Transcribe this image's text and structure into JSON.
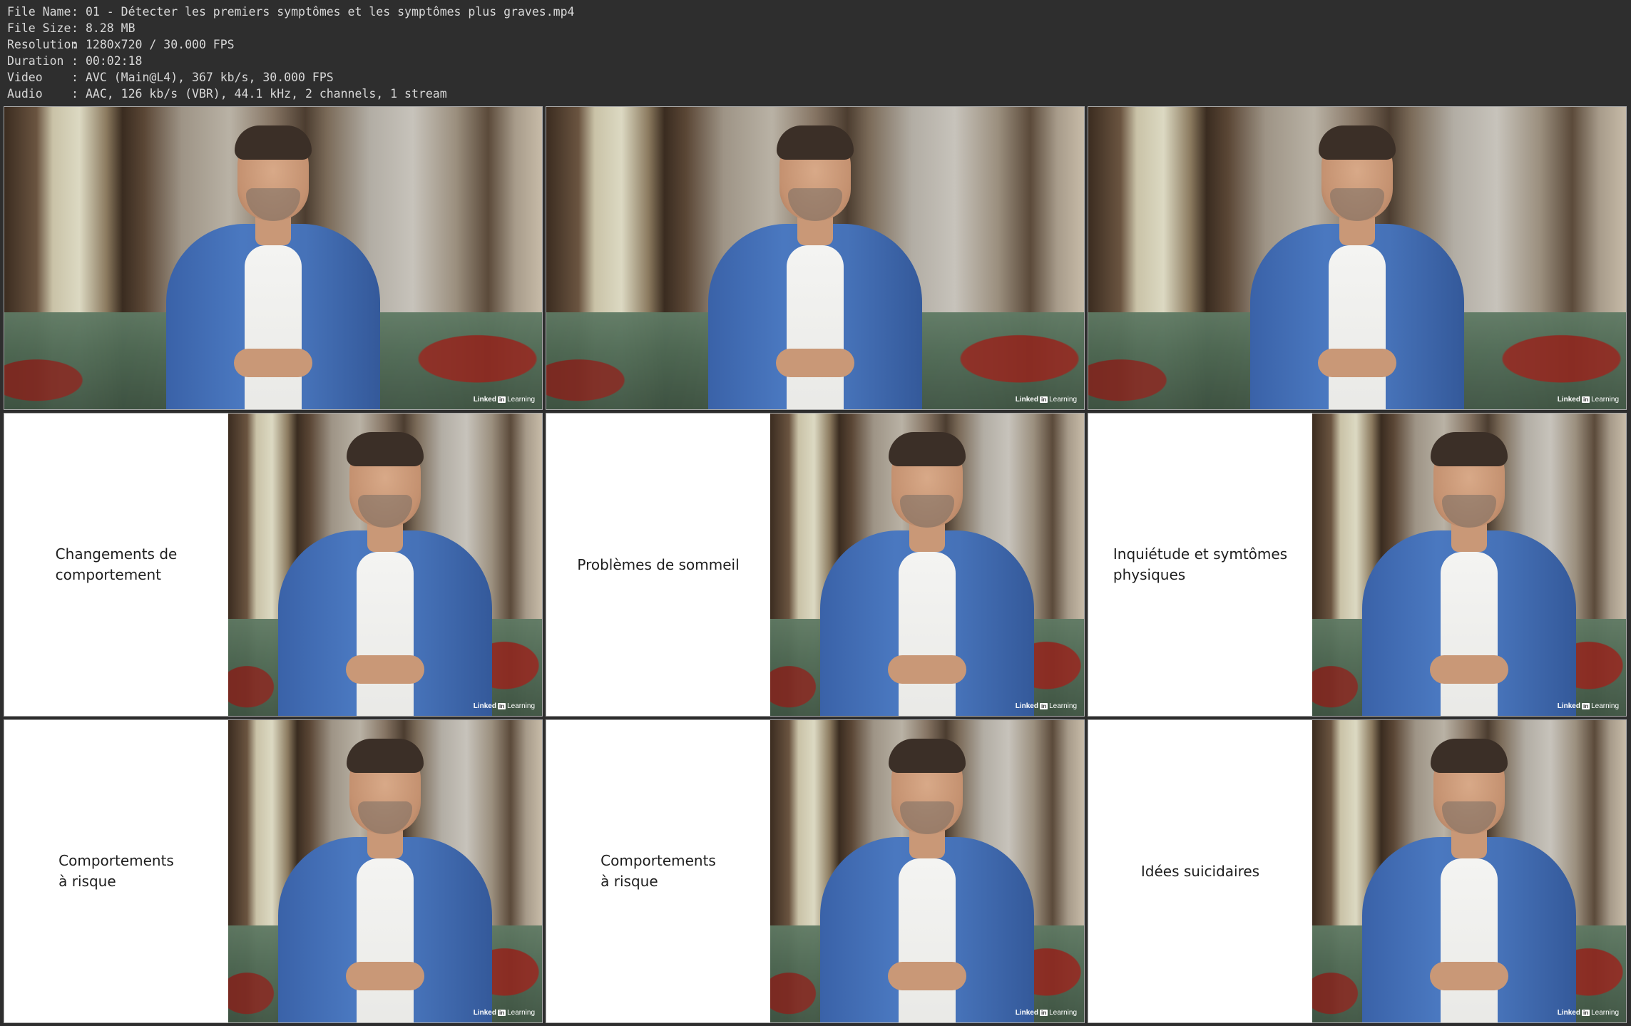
{
  "metadata": [
    {
      "key": "File Name",
      "sep": ":",
      "value": "01 - Détecter les premiers symptômes et les symptômes plus graves.mp4"
    },
    {
      "key": "File Size",
      "sep": ":",
      "value": "8.28 MB"
    },
    {
      "key": "Resolution",
      "sep": ":",
      "value": "1280x720 / 30.000 FPS"
    },
    {
      "key": "Duration",
      "sep": ":",
      "value": "00:02:18"
    },
    {
      "key": "Video",
      "sep": ":",
      "value": "AVC (Main@L4), 367 kb/s, 30.000 FPS"
    },
    {
      "key": "Audio",
      "sep": ":",
      "value": "AAC, 126 kb/s (VBR), 44.1 kHz, 2 channels, 1 stream"
    }
  ],
  "logo": {
    "linked": "Linked",
    "in": "in",
    "learning": "Learning"
  },
  "frames": [
    {
      "caption": ""
    },
    {
      "caption": ""
    },
    {
      "caption": ""
    },
    {
      "caption": "Changements de\ncomportement"
    },
    {
      "caption": "Problèmes de sommeil"
    },
    {
      "caption": "Inquiétude et symtômes\nphysiques"
    },
    {
      "caption": "Comportements\nà risque"
    },
    {
      "caption": "Comportements\nà risque"
    },
    {
      "caption": "Idées suicidaires"
    }
  ]
}
